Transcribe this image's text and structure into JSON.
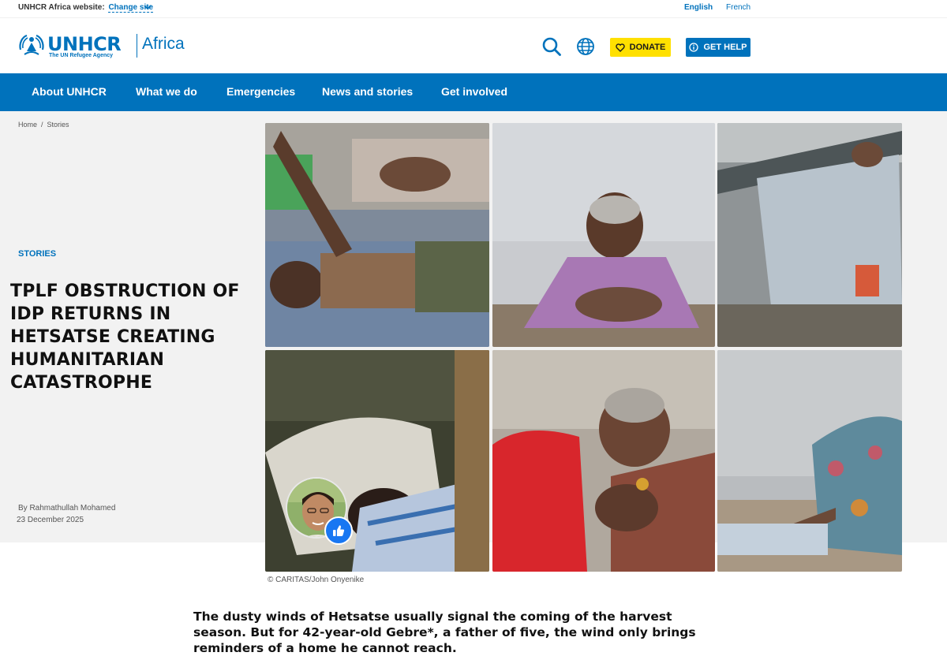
{
  "utility": {
    "site_label": "UNHCR Africa website:",
    "change_site": "Change site",
    "languages": [
      "English",
      "French"
    ]
  },
  "header": {
    "logo_word": "UNHCR",
    "logo_tagline": "The UN Refugee Agency",
    "region": "Africa",
    "donate_label": "DONATE",
    "gethelp_label": "GET HELP"
  },
  "nav": {
    "items": [
      "About UNHCR",
      "What we do",
      "Emergencies",
      "News and stories",
      "Get involved"
    ]
  },
  "breadcrumb": [
    "Home",
    "Stories"
  ],
  "article": {
    "eyebrow": "STORIES",
    "title": "TPLF OBSTRUCTION OF IDP RETURNS IN HETSATSE CREATING HUMANITARIAN CATASTROPHE",
    "byline": "By Rahmathullah Mohamed",
    "date": "23 December 2025",
    "credit": "© CARITAS/John Onyenike",
    "lead": "The dusty winds of Hetsatse usually signal the coming of the harvest season. But for 42-year-old Gebre*, a father of five, the wind only brings reminders of a home he cannot reach."
  },
  "colors": {
    "brand_blue": "#0072bc",
    "donate_yellow": "#ffe000",
    "like_blue": "#1877f2"
  }
}
